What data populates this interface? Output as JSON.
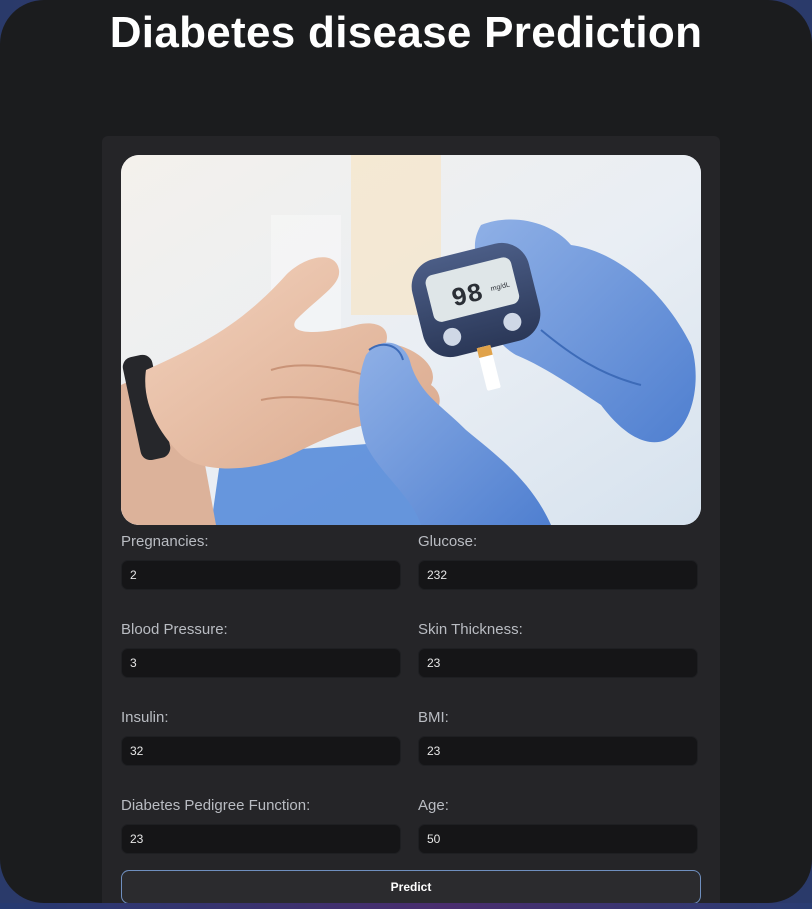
{
  "page": {
    "title": "Diabetes disease Prediction"
  },
  "hero": {
    "icon": "glucose-meter-image",
    "meter_reading": "98",
    "meter_unit": "mg/dL"
  },
  "form": {
    "fields": [
      {
        "label": "Pregnancies:",
        "value": "2"
      },
      {
        "label": "Glucose:",
        "value": "232"
      },
      {
        "label": "Blood Pressure:",
        "value": "3"
      },
      {
        "label": "Skin Thickness:",
        "value": "23"
      },
      {
        "label": "Insulin:",
        "value": "32"
      },
      {
        "label": "BMI:",
        "value": "23"
      },
      {
        "label": "Diabetes Pedigree Function:",
        "value": "23"
      },
      {
        "label": "Age:",
        "value": "50"
      }
    ],
    "submit_label": "Predict"
  },
  "colors": {
    "background": "#1b1c1e",
    "card": "#252528",
    "input": "#151517",
    "button_border": "#6f8fbf"
  }
}
